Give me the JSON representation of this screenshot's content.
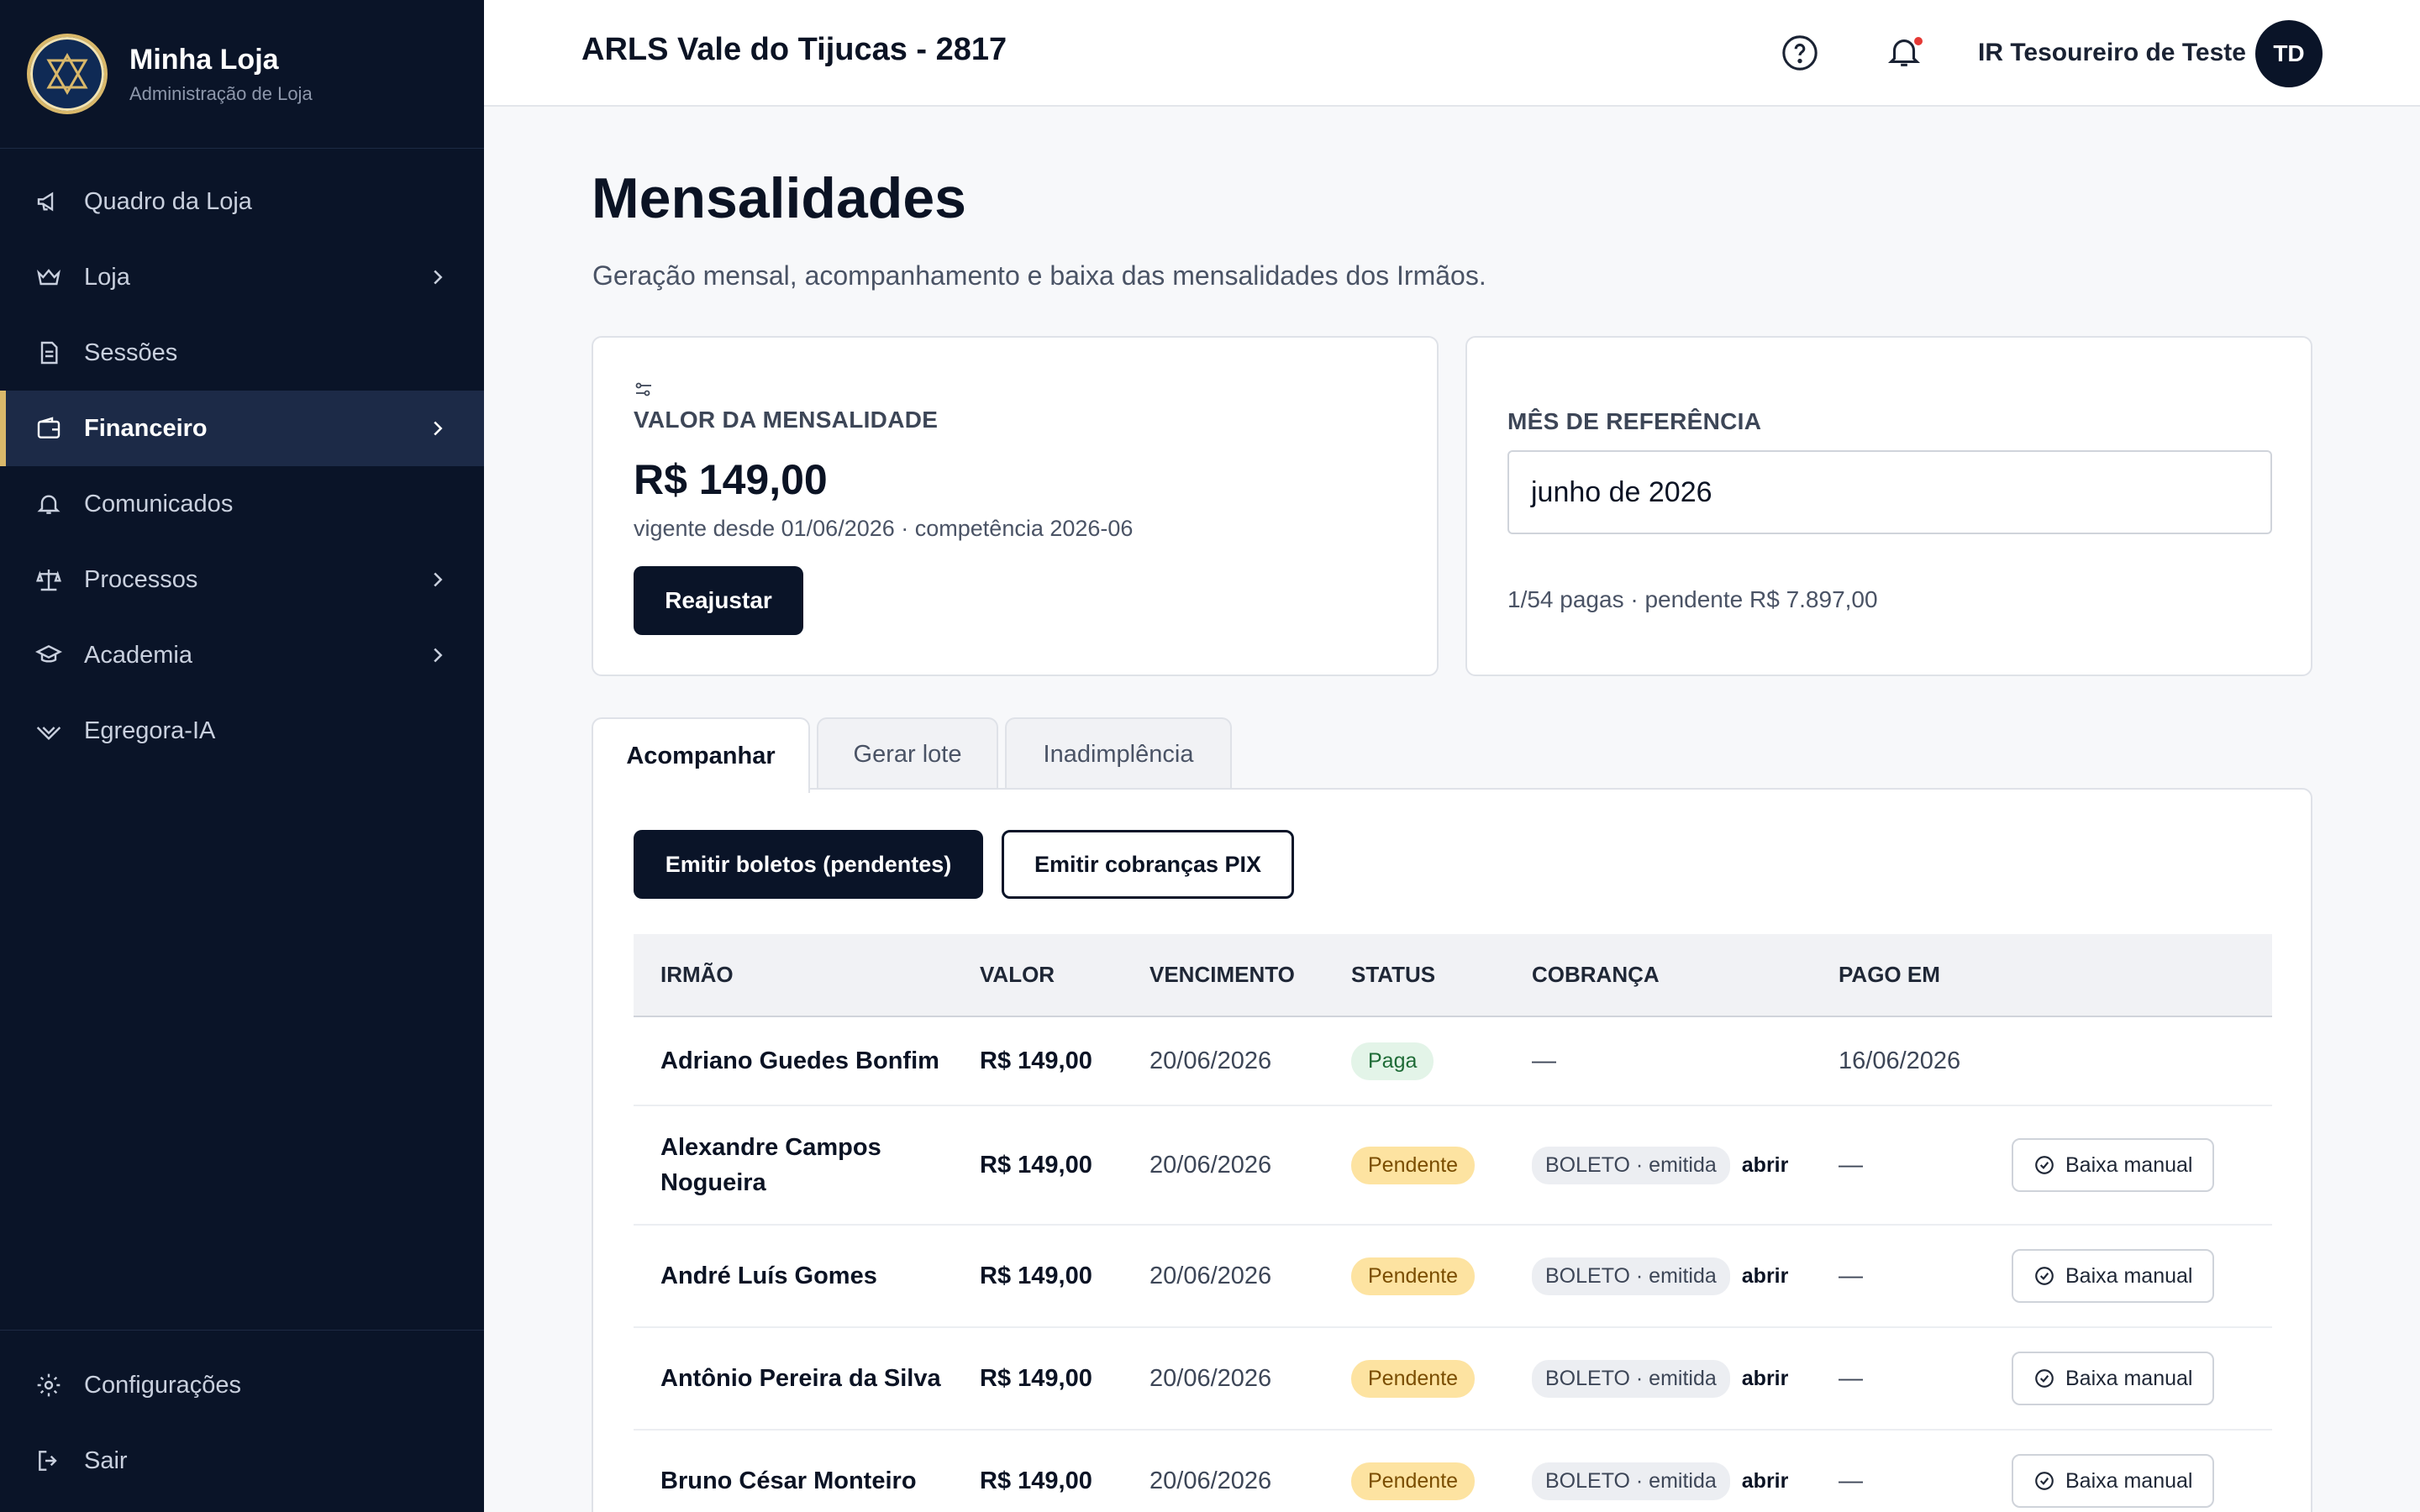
{
  "sidebar": {
    "brand_title": "Minha Loja",
    "brand_subtitle": "Administração de Loja",
    "items": [
      {
        "label": "Quadro da Loja",
        "icon": "megaphone-icon"
      },
      {
        "label": "Loja",
        "icon": "crown-icon"
      },
      {
        "label": "Sessões",
        "icon": "document-icon"
      },
      {
        "label": "Financeiro",
        "icon": "wallet-icon"
      },
      {
        "label": "Comunicados",
        "icon": "bell-icon"
      },
      {
        "label": "Processos",
        "icon": "scale-icon"
      },
      {
        "label": "Academia",
        "icon": "graduation-cap-icon"
      },
      {
        "label": "Egregora-IA",
        "icon": "spark-icon"
      }
    ],
    "bottom": [
      {
        "label": "Configurações",
        "icon": "gear-icon"
      },
      {
        "label": "Sair",
        "icon": "logout-icon"
      }
    ]
  },
  "topbar": {
    "org_name": "ARLS Vale do Tijucas - 2817",
    "user_name": "IR Tesoureiro de Teste",
    "avatar_initials": "TD"
  },
  "page": {
    "title": "Mensalidades",
    "subtitle": "Geração mensal, acompanhamento e baixa das mensalidades dos Irmãos."
  },
  "card_valor": {
    "label": "VALOR DA MENSALIDADE",
    "price": "R$ 149,00",
    "vigencia": "vigente desde 01/06/2026 · competência 2026-06",
    "button": "Reajustar"
  },
  "card_mes": {
    "label": "MÊS DE REFERÊNCIA",
    "value": "junho de 2026",
    "summary": "1/54 pagas · pendente R$ 7.897,00"
  },
  "tabs": [
    "Acompanhar",
    "Gerar lote",
    "Inadimplência"
  ],
  "actions": {
    "emit_boletos": "Emitir boletos (pendentes)",
    "emit_pix": "Emitir cobranças PIX"
  },
  "table": {
    "headers": [
      "IRMÃO",
      "VALOR",
      "VENCIMENTO",
      "STATUS",
      "COBRANÇA",
      "PAGO EM"
    ],
    "rows": [
      {
        "name": "Adriano Guedes Bonfim",
        "valor": "R$ 149,00",
        "vencimento": "20/06/2026",
        "status": "Paga",
        "cobranca": "—",
        "abrir": "",
        "pago_em": "16/06/2026",
        "action": ""
      },
      {
        "name": "Alexandre Campos Nogueira",
        "valor": "R$ 149,00",
        "vencimento": "20/06/2026",
        "status": "Pendente",
        "cobranca": "BOLETO · emitida",
        "abrir": "abrir",
        "pago_em": "—",
        "action": "Baixa manual"
      },
      {
        "name": "André Luís Gomes",
        "valor": "R$ 149,00",
        "vencimento": "20/06/2026",
        "status": "Pendente",
        "cobranca": "BOLETO · emitida",
        "abrir": "abrir",
        "pago_em": "—",
        "action": "Baixa manual"
      },
      {
        "name": "Antônio Pereira da Silva",
        "valor": "R$ 149,00",
        "vencimento": "20/06/2026",
        "status": "Pendente",
        "cobranca": "BOLETO · emitida",
        "abrir": "abrir",
        "pago_em": "—",
        "action": "Baixa manual"
      },
      {
        "name": "Bruno César Monteiro",
        "valor": "R$ 149,00",
        "vencimento": "20/06/2026",
        "status": "Pendente",
        "cobranca": "BOLETO · emitida",
        "abrir": "abrir",
        "pago_em": "—",
        "action": "Baixa manual"
      }
    ]
  },
  "colors": {
    "sidebar_bg": "#0a1428",
    "accent_gold": "#d9b86a",
    "status_paid": "#e3f4e8",
    "status_pending": "#fde3a1"
  }
}
